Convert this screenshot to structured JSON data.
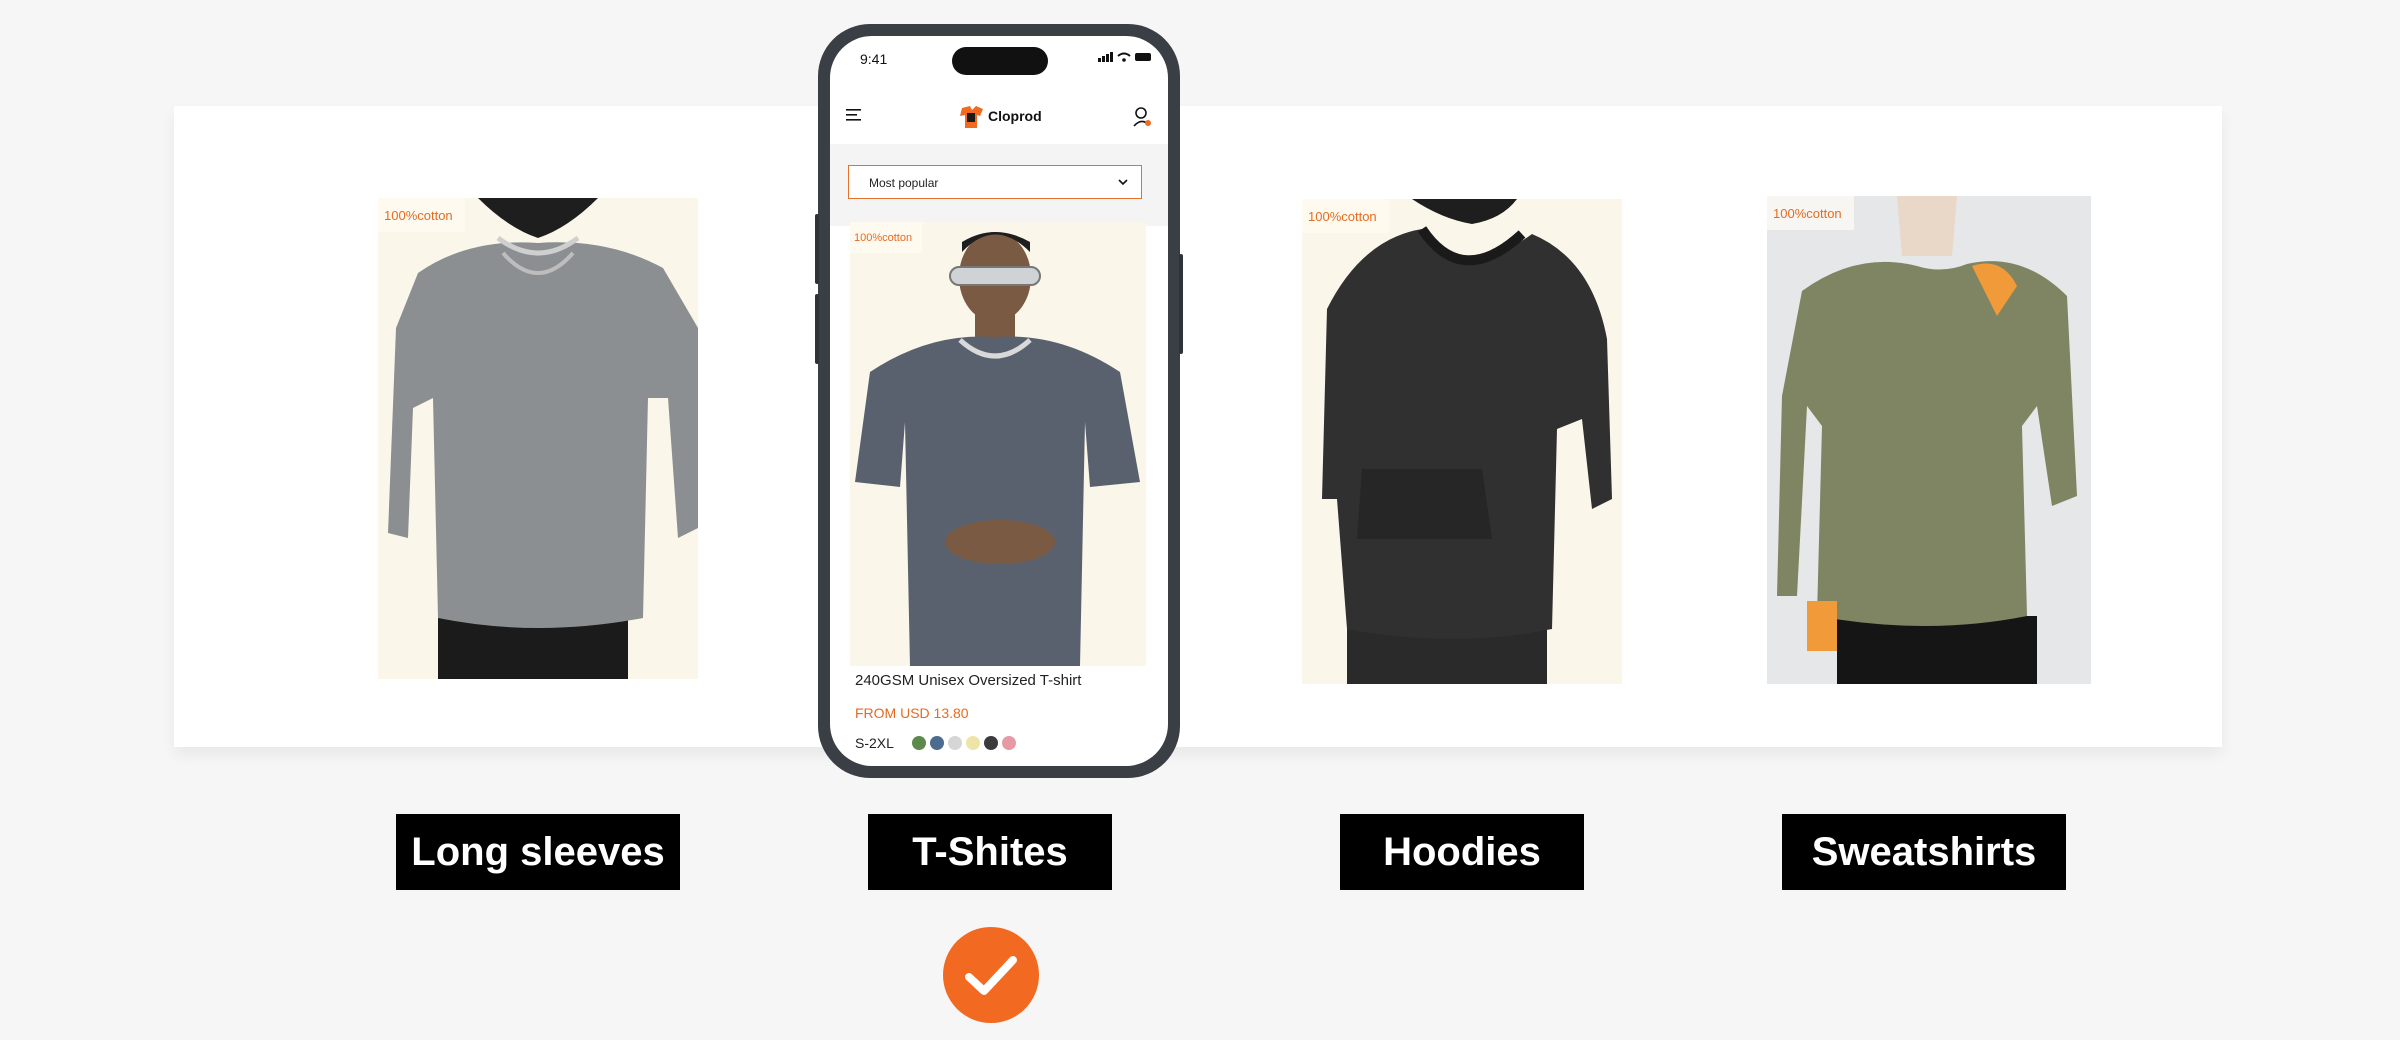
{
  "product_tag": "100%cotton",
  "categories": [
    {
      "label": "Long sleeves"
    },
    {
      "label": "T-Shites"
    },
    {
      "label": "Hoodies"
    },
    {
      "label": "Sweatshirts"
    }
  ],
  "phone": {
    "status_time": "9:41",
    "brand_name": "Cloprod",
    "sort_select_value": "Most popular",
    "product": {
      "title": "240GSM Unisex Oversized T-shirt",
      "price": "FROM USD 13.80",
      "sizes": "S-2XL",
      "swatch_colors": [
        "#5c8a4a",
        "#4b6b8f",
        "#d6d6d6",
        "#efe4a8",
        "#3b3b3b",
        "#e69aa4"
      ]
    }
  },
  "colors": {
    "accent": "#f26a21",
    "label_bg": "#000000",
    "label_text": "#ffffff"
  },
  "selected_category": "T-Shites"
}
